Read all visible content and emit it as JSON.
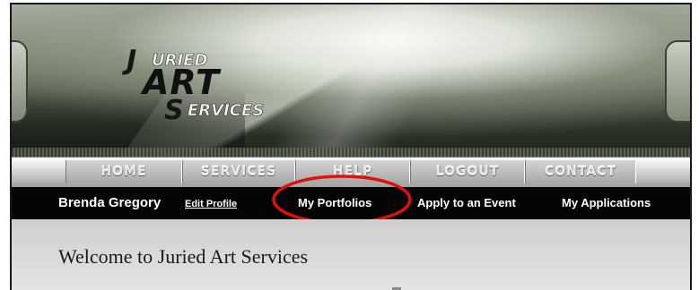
{
  "logo": {
    "line1": "JURIED",
    "line2": "ART",
    "line3": "SERVICES"
  },
  "nav": {
    "items": [
      {
        "label": "HOME"
      },
      {
        "label": "SERVICES"
      },
      {
        "label": "HELP"
      },
      {
        "label": "LOGOUT"
      },
      {
        "label": "CONTACT"
      }
    ]
  },
  "userbar": {
    "user_name": "Brenda Gregory",
    "edit_profile": "Edit Profile",
    "links": {
      "portfolios": "My Portfolios",
      "apply": "Apply to an Event",
      "applications": "My Applications"
    }
  },
  "content": {
    "welcome": "Welcome to Juried Art Services"
  },
  "colors": {
    "highlight_circle": "#e01010",
    "userbar_bg": "#050505"
  }
}
